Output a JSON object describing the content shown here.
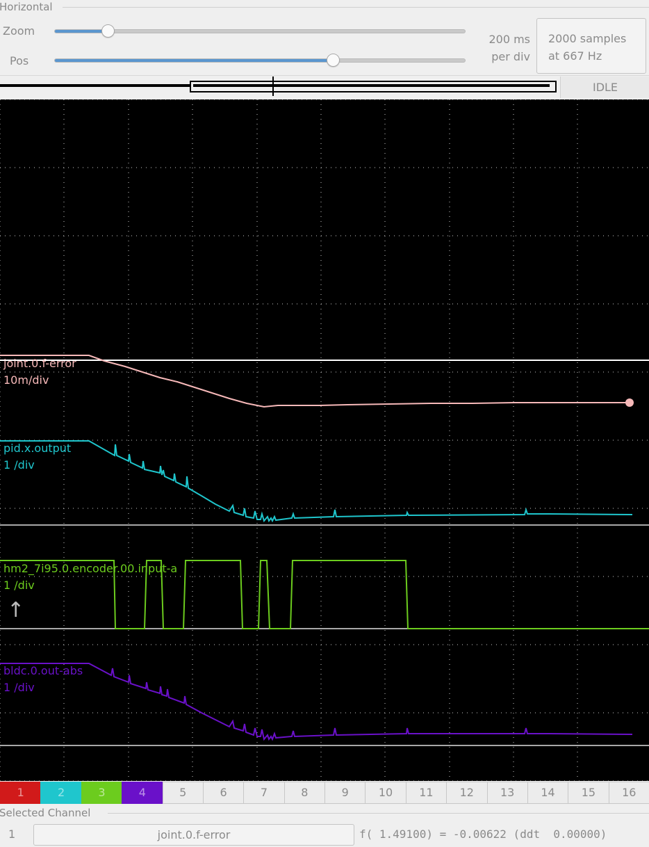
{
  "horizontal": {
    "title": "Horizontal",
    "zoom_label": "Zoom",
    "zoom_value": 0.13,
    "pos_label": "Pos",
    "pos_value": 0.68,
    "per_div_line1": "200 ms",
    "per_div_line2": "per div",
    "samples_line1": "2000 samples",
    "samples_line2": "at 667 Hz",
    "status": "IDLE"
  },
  "traces": [
    {
      "name": "joint.0.f-error",
      "scale": "10m/div",
      "color": "#f7b9b9"
    },
    {
      "name": "pid.x.output",
      "scale": "1 /div",
      "color": "#1fc6cd"
    },
    {
      "name": "hm2_7i95.0.encoder.00.input-a",
      "scale": "1 /div",
      "color": "#6ccc1e"
    },
    {
      "name": "bldc.0.out-abs",
      "scale": "1 /div",
      "color": "#6a11c9"
    }
  ],
  "channels": [
    {
      "label": "1",
      "color": "#d11a1a"
    },
    {
      "label": "2",
      "color": "#1fc6cd"
    },
    {
      "label": "3",
      "color": "#6ccc1e"
    },
    {
      "label": "4",
      "color": "#6a11c9"
    },
    {
      "label": "5"
    },
    {
      "label": "6"
    },
    {
      "label": "7"
    },
    {
      "label": "8"
    },
    {
      "label": "9"
    },
    {
      "label": "10"
    },
    {
      "label": "11"
    },
    {
      "label": "12"
    },
    {
      "label": "13"
    },
    {
      "label": "14"
    },
    {
      "label": "15"
    },
    {
      "label": "16"
    }
  ],
  "selected": {
    "title": "Selected Channel",
    "number": "1",
    "name": "joint.0.f-error",
    "readout": "f( 1.49100) = -0.00622 (ddt  0.00000)"
  }
}
